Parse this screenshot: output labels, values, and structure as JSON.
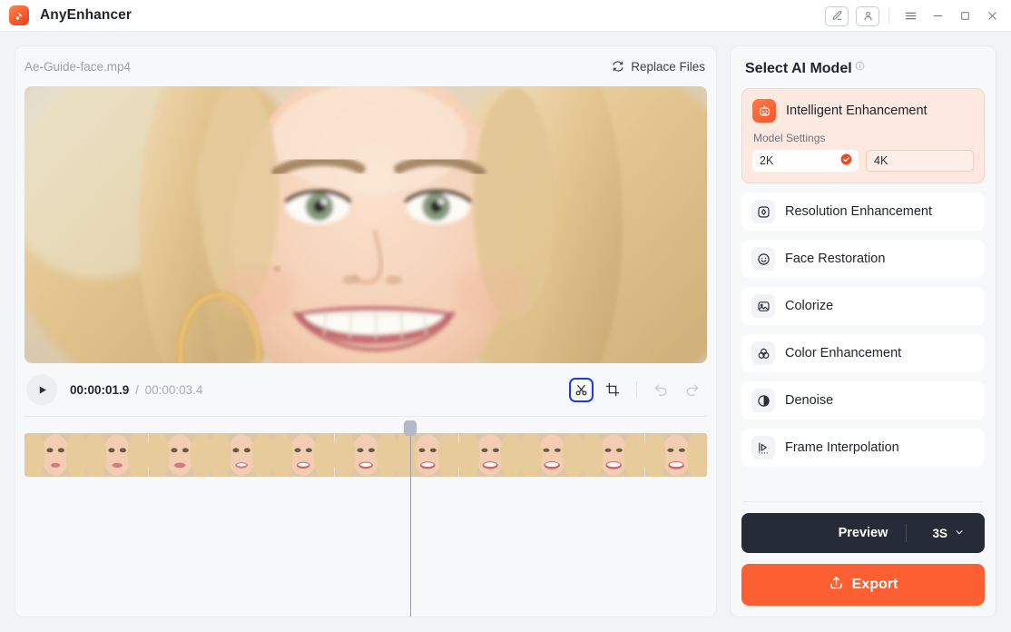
{
  "window": {
    "app_title": "AnyEnhancer",
    "logo_icon": "anyenhancer-logo-icon",
    "controls": {
      "edit_icon": "pen-edit-icon",
      "account_icon": "user-account-icon",
      "menu_icon": "hamburger-menu-icon",
      "minimize_icon": "minimize-icon",
      "maximize_icon": "maximize-icon",
      "close_icon": "close-icon"
    }
  },
  "editor": {
    "file_name": "Ae-Guide-face.mp4",
    "replace_label": "Replace Files",
    "replace_icon": "refresh-sync-icon",
    "player": {
      "play_icon": "play-icon",
      "current_time": "00:00:01.9",
      "separator": "/",
      "total_time": "00:00:03.4",
      "tools": [
        {
          "name": "trim-scissors",
          "icon": "scissors-icon",
          "active": true,
          "disabled": false
        },
        {
          "name": "crop",
          "icon": "crop-icon",
          "active": false,
          "disabled": false
        },
        {
          "name": "undo",
          "icon": "undo-icon",
          "active": false,
          "disabled": true
        },
        {
          "name": "redo",
          "icon": "redo-icon",
          "active": false,
          "disabled": true
        }
      ]
    },
    "timeline": {
      "frame_count": 11,
      "playhead_position_pct": 56.5
    }
  },
  "sidebar": {
    "title": "Select AI Model",
    "info_icon": "info-circle-icon",
    "active_model": {
      "name": "Intelligent Enhancement",
      "icon": "robot-icon",
      "settings_label": "Model Settings",
      "options": [
        {
          "label": "2K",
          "selected": true
        },
        {
          "label": "4K",
          "selected": false
        }
      ]
    },
    "models": [
      {
        "label": "Resolution Enhancement",
        "icon": "resolution-icon"
      },
      {
        "label": "Face Restoration",
        "icon": "smiley-face-icon"
      },
      {
        "label": "Colorize",
        "icon": "colorize-picture-icon"
      },
      {
        "label": "Color Enhancement",
        "icon": "color-circles-icon"
      },
      {
        "label": "Denoise",
        "icon": "denoise-contrast-icon"
      },
      {
        "label": "Frame Interpolation",
        "icon": "frame-play-icon"
      }
    ],
    "actions": {
      "preview_label": "Preview",
      "preview_duration": "3S",
      "preview_chevron_icon": "chevron-down-icon",
      "export_label": "Export",
      "export_icon": "upload-export-icon"
    }
  },
  "colors": {
    "accent_orange": "#fc5f31",
    "accent_card_bg": "#fde9e0",
    "dark_button": "#262b38",
    "focus_blue": "#1a38f5",
    "app_bg": "#f2f3f7"
  }
}
